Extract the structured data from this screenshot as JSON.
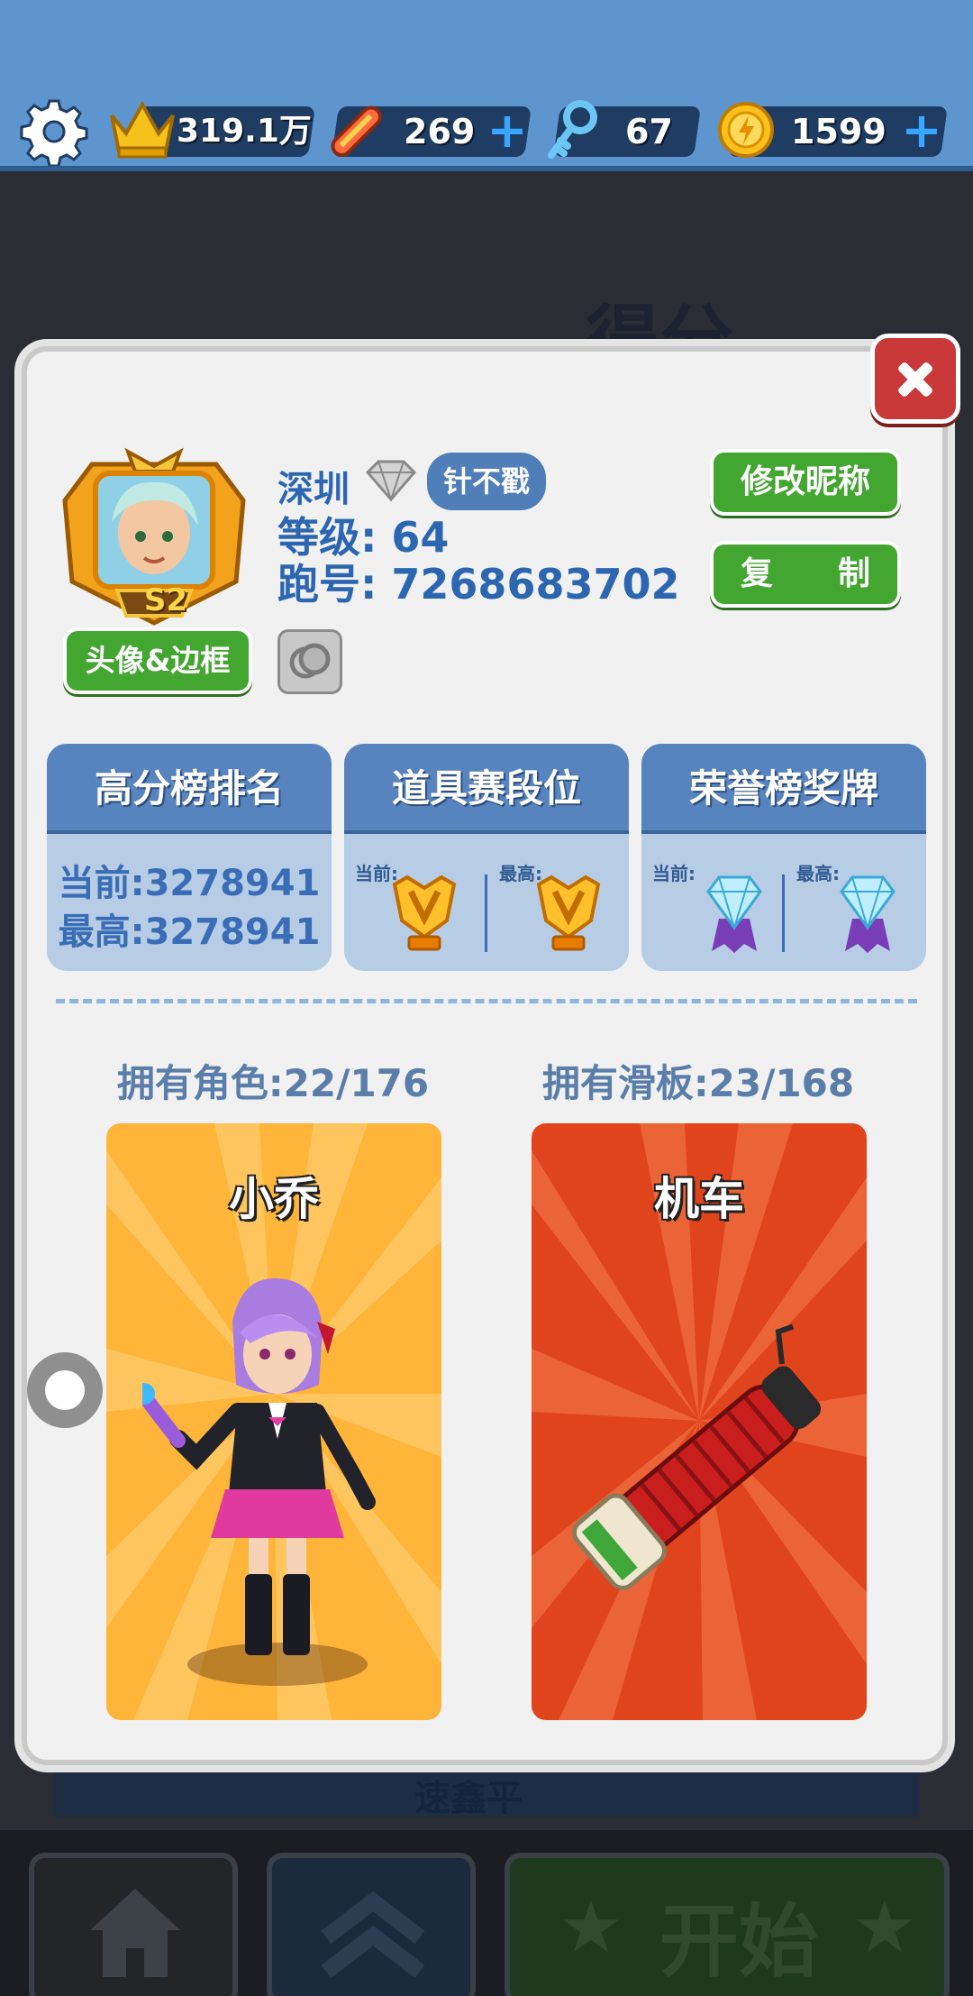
{
  "topbar": {
    "crown_value": "319.1万",
    "board_value": "269",
    "key_value": "67",
    "coin_value": "1599",
    "plus": "+"
  },
  "background": {
    "title": "得分",
    "row_name": "速鑫平"
  },
  "bottom": {
    "start_label": "开始"
  },
  "profile": {
    "city": "深圳",
    "title_badge": "针不戳",
    "level": "等级: 64",
    "run_id": "跑号: 7268683702",
    "avatar_season": "S2",
    "avatar_button": "头像&边框",
    "rename_button": "修改昵称",
    "copy_button": "复　　制"
  },
  "cards": [
    {
      "header": "高分榜排名",
      "current": "当前:3278941",
      "best": "最高:3278941"
    },
    {
      "header": "道具赛段位",
      "current_label": "当前:",
      "best_label": "最高:"
    },
    {
      "header": "荣誉榜奖牌",
      "current_label": "当前:",
      "best_label": "最高:"
    }
  ],
  "ownership": {
    "characters": "拥有角色:22/176",
    "boards": "拥有滑板:23/168"
  },
  "showcase": {
    "character_name": "小乔",
    "board_name": "机车"
  },
  "colors": {
    "topbar": "#5f95cf",
    "green_button": "#43a631",
    "card_header": "#5784bf",
    "character_bg": "#ffb43a",
    "board_bg": "#e0441c"
  }
}
